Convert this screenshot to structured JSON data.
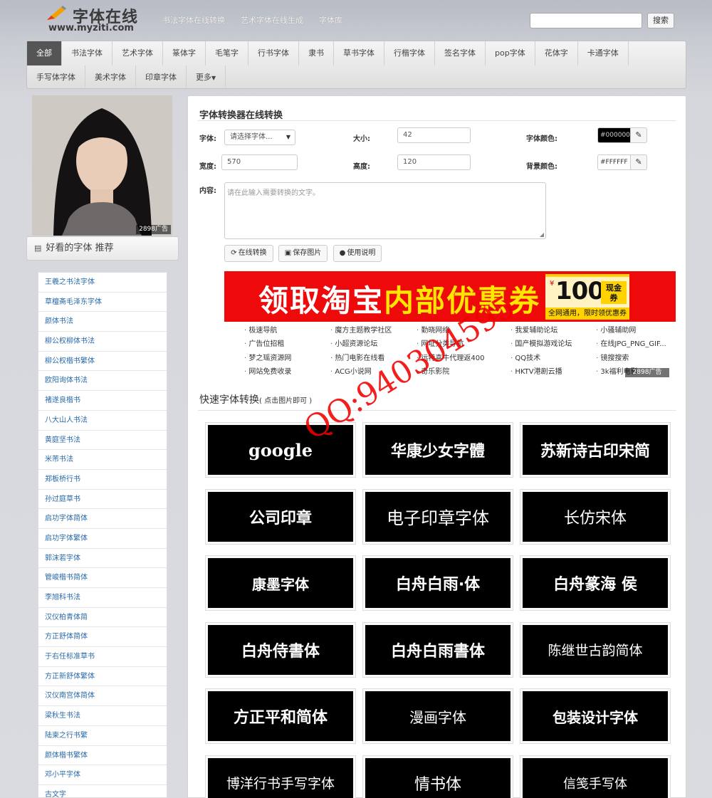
{
  "header": {
    "logo_title": "字体在线",
    "logo_url": "www.myziti.com",
    "nav": [
      "书法字体在线转换",
      "艺术字体在线生成",
      "字体库"
    ],
    "search_button": "搜索"
  },
  "categories": {
    "row1": [
      "全部",
      "书法字体",
      "艺术字体",
      "篆体字",
      "毛笔字",
      "行书字体",
      "隶书",
      "草书字体",
      "行楷字体",
      "签名字体",
      "pop字体",
      "花体字",
      "卡通字体"
    ],
    "row2": [
      "手写体字体",
      "美术字体",
      "印章字体",
      "更多"
    ]
  },
  "left": {
    "ad_label": "2898广告",
    "rec_title": "好看的字体 推荐",
    "rec_items": [
      "王羲之书法字体",
      "草檀斋毛泽东字体",
      "颜体书法",
      "柳公权柳体书法",
      "柳公权楷书繁体",
      "欧阳询体书法",
      "褚遂良楷书",
      "八大山人书法",
      "黄庭坚书法",
      "米芾书法",
      "郑板桥行书",
      "孙过庭草书",
      "启功字体简体",
      "启功字体繁体",
      "郭沫若字体",
      "管峻楷书简体",
      "李旭科书法",
      "汉仪柏青体简",
      "方正舒体简体",
      "于右任标准草书",
      "方正新舒体繁体",
      "汉仪南宫体简体",
      "梁秋生书法",
      "陆柬之行书繁",
      "颜体楷书繁体",
      "邓小平字体",
      "古文字"
    ]
  },
  "form": {
    "title": "字体转换器在线转换",
    "font_label": "字体:",
    "font_select": "请选择字体...",
    "size_label": "大小:",
    "size_value": "42",
    "color_label": "字体颜色:",
    "color_value": "#000000",
    "width_label": "宽度:",
    "width_value": "570",
    "height_label": "高度:",
    "height_value": "120",
    "bg_label": "背景颜色:",
    "bg_value": "#FFFFFF",
    "content_label": "内容:",
    "content_placeholder": "请在此输入需要转换的文字。",
    "btn_convert": "在线转换",
    "btn_save": "保存图片",
    "btn_help": "使用说明"
  },
  "banner": {
    "text_white": "领取淘宝",
    "text_yellow": "内部优惠券",
    "currency": "¥",
    "amount": "100",
    "cash_top": "现金",
    "cash_bottom": "券",
    "coupon_sub": "全网通用，限时领优惠券"
  },
  "links": [
    "极速导航",
    "魔方主题教学社区",
    "勤晓网络",
    "我爱辅助论坛",
    "小骚辅助网",
    "广告位招租",
    "小超资源论坛",
    "网址分类导航",
    "国产模拟游戏论坛",
    "在线JPG_PNG_GIF...",
    "梦之瑶资源网",
    "热门电影在线看",
    "远特喜牛代理返400",
    "QQ技术",
    "镜搜搜索",
    "网站免费收录",
    "ACG小说网",
    "奇乐影院",
    "HKTV港剧云播",
    "3k福利电影"
  ],
  "links_ad_label": "2898广告",
  "quick": {
    "title": "快速字体转换",
    "hint": "( 点击图片即可 )",
    "tiles": [
      "google",
      "华康少女字體",
      "苏新诗古印宋简",
      "公司印章",
      "电子印章字体",
      "长仿宋体",
      "康墨字体",
      "白舟白雨·体",
      "白舟篆海 侯",
      "白舟侍書体",
      "白舟白雨書体",
      "陈继世古韵简体",
      "方正平和简体",
      "漫画字体",
      "包装设计字体",
      "博洋行书手写字体",
      "情书体",
      "信笺手写体"
    ]
  },
  "watermark": "QQ:940304595",
  "colors": {
    "active_tab": "#555555",
    "link_blue": "#2a6aa8",
    "banner_red": "#ee0a0a",
    "banner_yellow": "#ffe600"
  }
}
